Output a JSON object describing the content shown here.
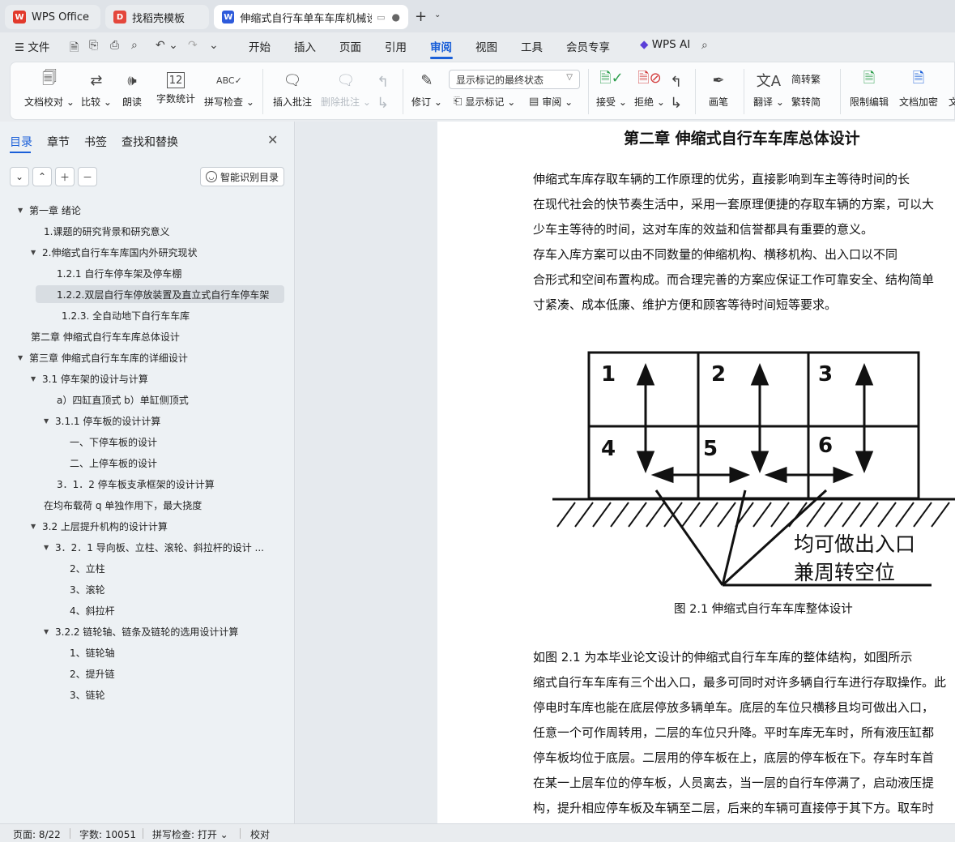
{
  "tabs": [
    {
      "label": "WPS Office"
    },
    {
      "label": "找稻壳模板"
    },
    {
      "label": "伸缩式自行车单车车库机械设",
      "ext": "▭"
    }
  ],
  "menu": {
    "file": "文件",
    "items": [
      "开始",
      "插入",
      "页面",
      "引用",
      "审阅",
      "视图",
      "工具",
      "会员专享"
    ],
    "wps_ai": "WPS AI",
    "active": "审阅"
  },
  "ribbon": {
    "doc_check": "文档校对",
    "compare": "比较",
    "read_aloud": "朗读",
    "word_count": "字数统计",
    "spell_check": "拼写检查",
    "insert_comment": "插入批注",
    "delete_comment": "删除批注",
    "revise": "修订",
    "display_mode": "显示标记的最终状态",
    "show_markup": "显示标记",
    "review": "审阅",
    "accept": "接受",
    "reject": "拒绝",
    "pen": "画笔",
    "translate": "翻译",
    "to_traditional": "简转繁",
    "to_simplified": "繁转简",
    "restrict_edit": "限制编辑",
    "doc_encrypt": "文档加密",
    "doc_more": "文",
    "word_count_icon": "12"
  },
  "nav": {
    "tabs": [
      "目录",
      "章节",
      "书签",
      "查找和替换"
    ],
    "smart_toc": "智能识别目录",
    "toc": [
      {
        "text": "第一章  绪论",
        "arrow": "▼"
      },
      {
        "text": "1.课题的研究背景和研究意义",
        "arrow": ""
      },
      {
        "text": "2.伸缩式自行车车库国内外研究现状",
        "arrow": "▼"
      },
      {
        "text": "1.2.1    自行车停车架及停车棚",
        "arrow": ""
      },
      {
        "text": "1.2.2.双层自行车停放装置及直立式自行车停车架",
        "arrow": ""
      },
      {
        "text": "1.2.3.  全自动地下自行车车库",
        "arrow": ""
      },
      {
        "text": "第二章  伸缩式自行车车库总体设计",
        "arrow": ""
      },
      {
        "text": "第三章  伸缩式自行车车库的详细设计",
        "arrow": "▼"
      },
      {
        "text": "3.1    停车架的设计与计算",
        "arrow": "▼"
      },
      {
        "text": "a）四缸直顶式    b）单缸侧顶式",
        "arrow": ""
      },
      {
        "text": "3.1.1    停车板的设计计算",
        "arrow": "▼"
      },
      {
        "text": "一、下停车板的设计",
        "arrow": ""
      },
      {
        "text": "二、上停车板的设计",
        "arrow": ""
      },
      {
        "text": "3．1．2    停车板支承框架的设计计算",
        "arrow": ""
      },
      {
        "text": "在均布载荷 q 单独作用下，最大挠度",
        "arrow": ""
      },
      {
        "text": "3.2    上层提升机构的设计计算",
        "arrow": "▼"
      },
      {
        "text": "3．2．1    导向板、立柱、滚轮、斜拉杆的设计 ...",
        "arrow": "▼"
      },
      {
        "text": "2、立柱",
        "arrow": ""
      },
      {
        "text": "3、滚轮",
        "arrow": ""
      },
      {
        "text": "4、斜拉杆",
        "arrow": ""
      },
      {
        "text": "3.2.2    链轮轴、链条及链轮的选用设计计算",
        "arrow": "▼"
      },
      {
        "text": "1、链轮轴",
        "arrow": ""
      },
      {
        "text": "2、提升链",
        "arrow": ""
      },
      {
        "text": "3、链轮",
        "arrow": ""
      }
    ]
  },
  "document": {
    "title": "第二章  伸缩式自行车车库总体设计",
    "paragraphs": [
      "    伸缩式车库存取车辆的工作原理的优劣，直接影响到车主等待时间的长",
      "在现代社会的快节奏生活中，采用一套原理便捷的存取车辆的方案，可以大",
      "少车主等待的时间，这对车库的效益和信誉都具有重要的意义。",
      "     存车入库方案可以由不同数量的伸缩机构、横移机构、出入口以不同",
      "合形式和空间布置构成。而合理完善的方案应保证工作可靠安全、结构简单",
      "寸紧凑、成本低廉、维护方便和顾客等待时间短等要求。"
    ],
    "figure": {
      "cells": [
        "1",
        "2",
        "3",
        "4",
        "5",
        "6"
      ],
      "label_line1": "均可做出入口",
      "label_line2": "兼周转空位"
    },
    "caption": "图 2.1 伸缩式自行车车库整体设计",
    "paragraphs2": [
      "    如图 2.1 为本毕业论文设计的伸缩式自行车车库的整体结构，如图所示",
      "缩式自行车车库有三个出入口，最多可同时对许多辆自行车进行存取操作。此",
      "停电时车库也能在底层停放多辆单车。底层的车位只横移且均可做出入口，",
      "任意一个可作周转用，二层的车位只升降。平时车库无车时，所有液压缸都",
      "停车板均位于底层。二层用的停车板在上，底层的停车板在下。存车时车首",
      "在某一上层车位的停车板，人员离去，当一层的自行车停满了，启动液压提",
      "构，提升相应停车板及车辆至二层，后来的车辆可直接停于其下方。取车时"
    ]
  },
  "status": {
    "page": "页面: 8/22",
    "words": "字数: 10051",
    "spell": "拼写检查: 打开",
    "proof": "校对"
  }
}
